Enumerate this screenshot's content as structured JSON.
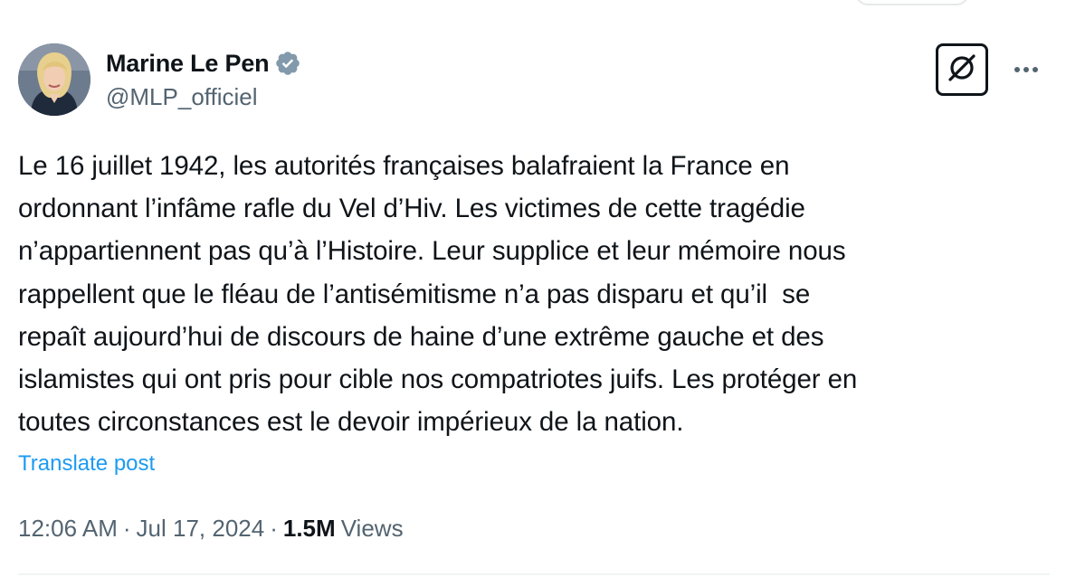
{
  "author": {
    "display_name": "Marine Le Pen",
    "handle": "@MLP_officiel",
    "verified_icon": "verified-badge-icon",
    "avatar_icon": "avatar"
  },
  "actions": {
    "grok_icon": "grok-icon",
    "more_icon": "more-horizontal-icon"
  },
  "tweet": {
    "lines": [
      "Le 16 juillet 1942, les autorités françaises balafraient la France en",
      "ordonnant l’infâme rafle du Vel d’Hiv. Les victimes de cette tragédie",
      "n’appartiennent pas qu’à l’Histoire. Leur supplice et leur mémoire nous",
      "rappellent que le fléau de l’antisémitisme n’a pas disparu et qu’il  se",
      "repaît aujourd’hui de discours de haine d’une extrême gauche et des",
      "islamistes qui ont pris pour cible nos compatriotes juifs. Les protéger en",
      "toutes circonstances est le devoir impérieux de la nation."
    ],
    "translate_label": "Translate post"
  },
  "meta": {
    "time": "12:06 AM",
    "separator": "·",
    "date": "Jul 17, 2024",
    "views_count": "1.5M",
    "views_label": "Views"
  },
  "colors": {
    "text_primary": "#0f1419",
    "text_secondary": "#536471",
    "link": "#1d9bf0",
    "verified": "#829aab",
    "divider": "#eff3f4"
  }
}
